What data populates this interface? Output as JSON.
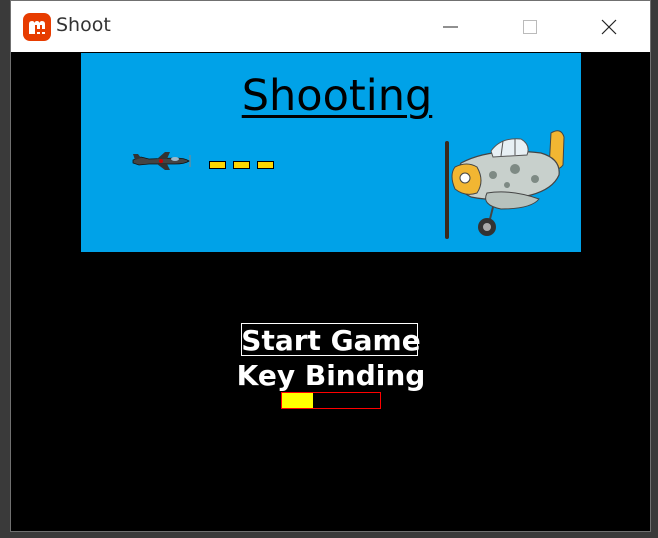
{
  "window": {
    "title": "Shoot",
    "icon": "monogame-logo-icon",
    "controls": [
      "minimize-icon",
      "maximize-icon",
      "close-icon"
    ]
  },
  "game": {
    "title": "Shooting",
    "banner_color": "#00a2e8",
    "bullet_color": "#ffd700",
    "bullet_count": 3
  },
  "menu": {
    "items": [
      {
        "label": "Start Game",
        "selected": true
      },
      {
        "label": "Key Binding",
        "selected": false
      }
    ],
    "progress_fraction": 0.32,
    "progress_fill_color": "#ffff00",
    "progress_border_color": "#ff0000"
  },
  "colors": {
    "accent": "#e73c00",
    "background": "#000000"
  }
}
